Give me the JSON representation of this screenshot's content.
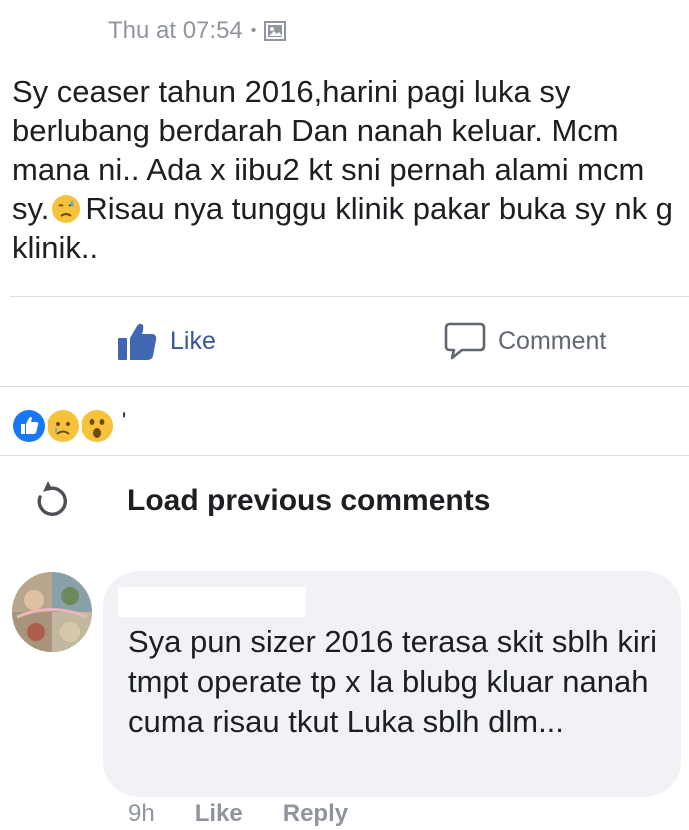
{
  "post": {
    "timestamp": "Thu at 07:54",
    "separator": "•",
    "privacy_icon": "photo-album-icon",
    "text_part1": "Sy ceaser tahun 2016,harini pagi luka sy berlubang berdarah Dan nanah keluar. Mcm mana ni.. Ada x iibu2 kt sni pernah alami mcm sy.",
    "emoji": "sad-relieved-emoji",
    "text_part2": "Risau nya tunggu klinik pakar buka sy nk g klinik.."
  },
  "actions": {
    "like_label": "Like",
    "like_icon": "thumbs-up-icon",
    "comment_label": "Comment",
    "comment_icon": "speech-bubble-icon"
  },
  "reactions": {
    "icons": [
      "like-reaction",
      "sad-reaction",
      "wow-reaction"
    ],
    "trailing_text": "'"
  },
  "comments_section": {
    "load_previous_label": "Load previous comments",
    "load_icon": "reload-icon"
  },
  "comment": {
    "author_name": "",
    "text": "Sya pun sizer 2016 terasa skit sblh kiri tmpt operate tp x la blubg kluar nanah cuma risau tkut Luka sblh dlm...",
    "time": "9h",
    "like_label": "Like",
    "reply_label": "Reply"
  },
  "colors": {
    "like_blue": "#365899",
    "secondary_gray": "#90949c",
    "bubble_bg": "#f0f2f5",
    "divider": "#dadde1"
  }
}
